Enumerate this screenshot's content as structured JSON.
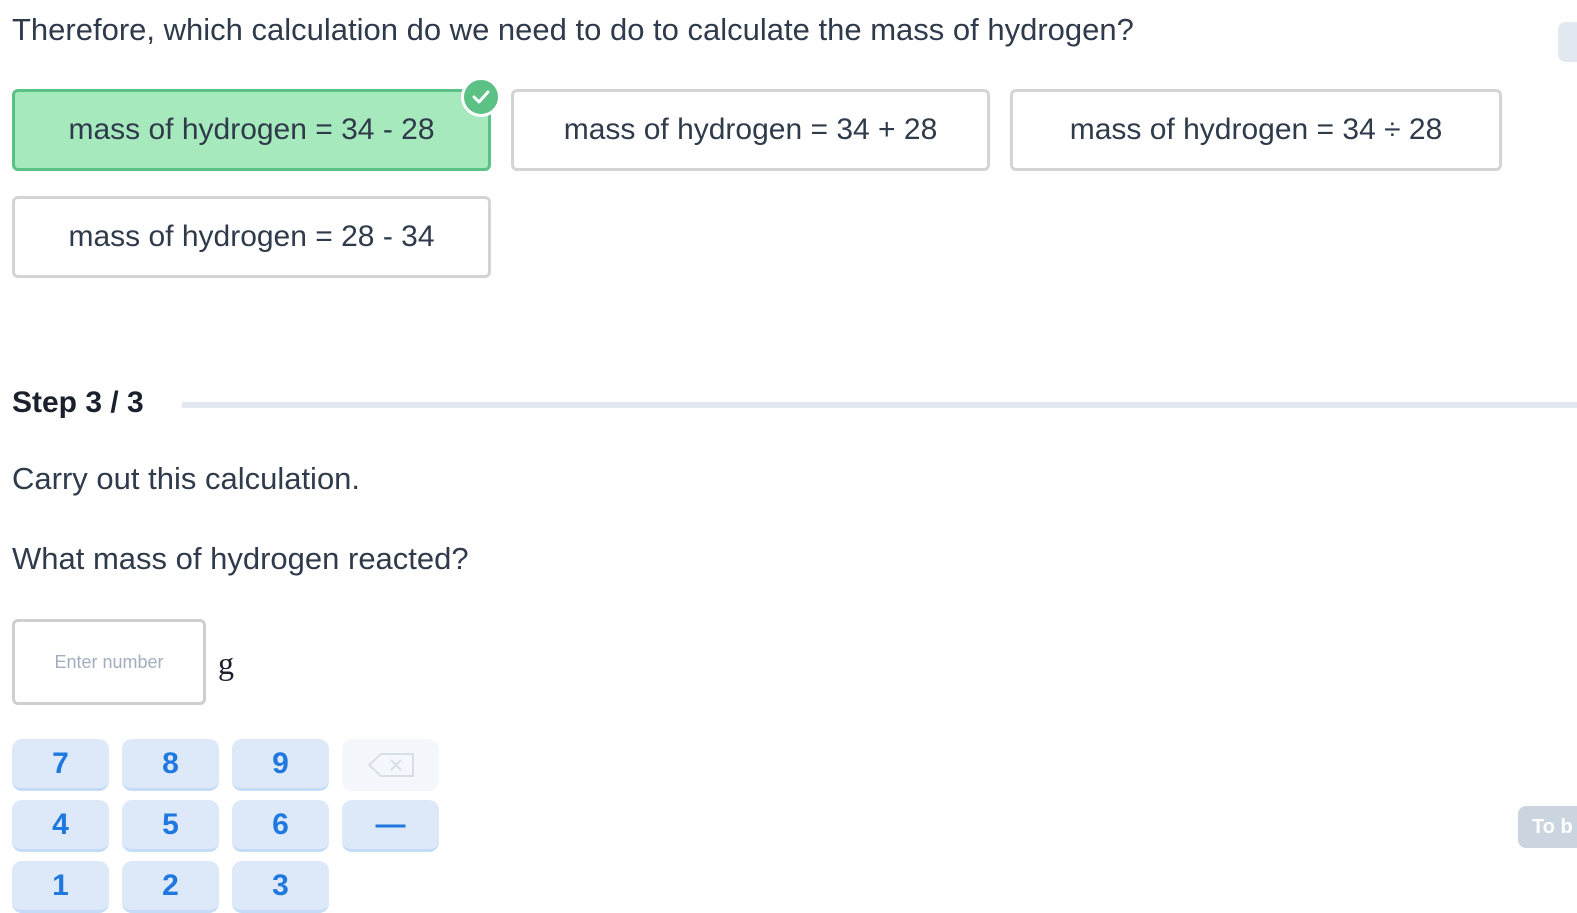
{
  "question": "Therefore, which calculation do we need to do to calculate the mass of hydrogen?",
  "options": [
    {
      "label": "mass of hydrogen = 34 - 28",
      "selected": true
    },
    {
      "label": "mass of hydrogen = 34 + 28",
      "selected": false
    },
    {
      "label": "mass of hydrogen = 34 ÷ 28",
      "selected": false
    },
    {
      "label": "mass of hydrogen = 28 - 34",
      "selected": false
    }
  ],
  "step": {
    "label": "Step 3 / 3",
    "current": 3,
    "total": 3
  },
  "instruction": "Carry out this calculation.",
  "prompt": "What mass of hydrogen reacted?",
  "answer": {
    "placeholder": "Enter number",
    "value": "",
    "unit": "g"
  },
  "keypad": {
    "keys": [
      "7",
      "8",
      "9",
      "4",
      "5",
      "6",
      "1",
      "2",
      "3"
    ],
    "backspace_icon": "backspace-icon",
    "minus_label": "—"
  },
  "submit_label": "To b",
  "colors": {
    "correct": "#5bc184",
    "correct_bg": "#a6e9bd",
    "key_text": "#1f78e0",
    "key_bg": "#dde9f8"
  }
}
